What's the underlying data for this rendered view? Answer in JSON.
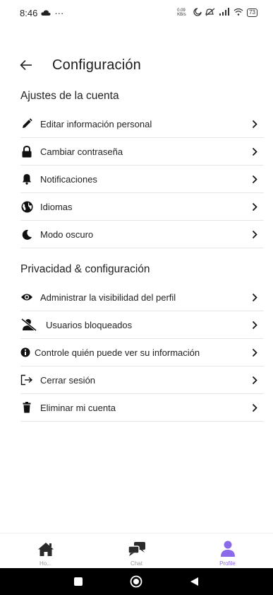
{
  "status_bar": {
    "time": "8:46",
    "dots": "···",
    "net_speed": "0.09 KB/s",
    "battery": "73"
  },
  "header": {
    "title": "Configuración"
  },
  "sections": [
    {
      "title": "Ajustes de la cuenta",
      "items": [
        {
          "label": "Editar información personal",
          "icon": "pencil-icon"
        },
        {
          "label": "Cambiar contraseña",
          "icon": "lock-icon"
        },
        {
          "label": "Notificaciones",
          "icon": "bell-icon"
        },
        {
          "label": "Idiomas",
          "icon": "globe-icon"
        },
        {
          "label": "Modo oscuro",
          "icon": "moon-icon"
        }
      ]
    },
    {
      "title": "Privacidad & configuración",
      "items": [
        {
          "label": "Administrar la visibilidad del perfil",
          "icon": "eye-icon"
        },
        {
          "label": "Usuarios bloqueados",
          "icon": "user-slash-icon"
        },
        {
          "label": "Controle quién puede ver su información",
          "icon": "info-circle-icon"
        },
        {
          "label": "Cerrar sesión",
          "icon": "logout-icon"
        },
        {
          "label": "Eliminar mi cuenta",
          "icon": "trash-icon"
        }
      ]
    }
  ],
  "bottom_nav": {
    "items": [
      {
        "label": "Ho...",
        "icon": "home-icon"
      },
      {
        "label": "Chat",
        "icon": "chat-bubbles-icon"
      },
      {
        "label": "Profile",
        "icon": "person-icon"
      }
    ],
    "active_color": "#8a6ae8"
  }
}
